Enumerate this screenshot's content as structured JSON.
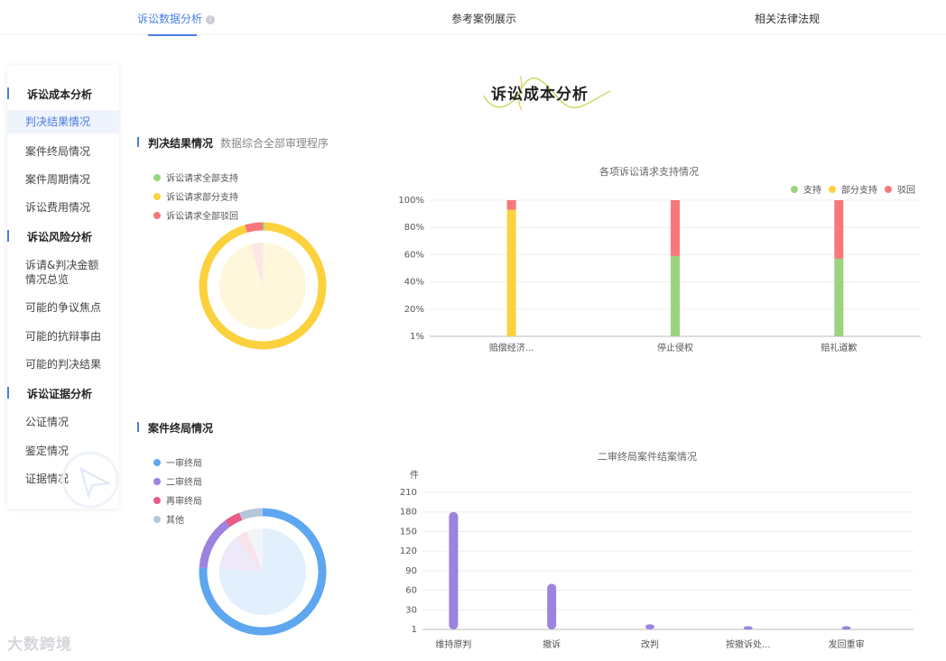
{
  "tabs": [
    {
      "label": "诉讼数据分析",
      "active": true
    },
    {
      "label": "参考案例展示",
      "active": false
    },
    {
      "label": "相关法律法规",
      "active": false
    }
  ],
  "sidebar": {
    "groups": [
      {
        "label": "诉讼成本分析",
        "items": [
          "判决结果情况",
          "案件终局情况",
          "案件周期情况",
          "诉讼费用情况"
        ]
      },
      {
        "label": "诉讼风险分析",
        "items": [
          "诉请&判决金额情况总览",
          "可能的争议焦点",
          "可能的抗辩事由",
          "可能的判决结果"
        ]
      },
      {
        "label": "诉讼证据分析",
        "items": [
          "公证情况",
          "鉴定情况",
          "证据情况"
        ]
      }
    ],
    "active_item": "判决结果情况"
  },
  "main_title": "诉讼成本分析",
  "section1": {
    "title": "判决结果情况",
    "subtitle": "数据综合全部审理程序",
    "legend": [
      {
        "label": "诉讼请求全部支持",
        "color": "#9bd47e"
      },
      {
        "label": "诉讼请求部分支持",
        "color": "#fcd13e"
      },
      {
        "label": "诉讼请求全部驳回",
        "color": "#f8777a"
      }
    ]
  },
  "section2": {
    "title": "案件终局情况",
    "legend": [
      {
        "label": "一审终局",
        "color": "#5ea7f0"
      },
      {
        "label": "二审终局",
        "color": "#9b83df"
      },
      {
        "label": "再审终局",
        "color": "#e85c86"
      },
      {
        "label": "其他",
        "color": "#b6c6d9"
      }
    ]
  },
  "chart_data": [
    {
      "type": "pie",
      "slices": [
        {
          "label": "诉讼请求全部支持",
          "value": 0.5,
          "color": "#9bd47e"
        },
        {
          "label": "诉讼请求部分支持",
          "value": 95,
          "color": "#fcd13e"
        },
        {
          "label": "诉讼请求全部驳回",
          "value": 4.5,
          "color": "#f8777a"
        }
      ]
    },
    {
      "type": "bar",
      "stacked": true,
      "title": "各项诉讼请求支持情况",
      "categories": [
        "赔偿经济...",
        "停止侵权",
        "赔礼道歉"
      ],
      "series": [
        {
          "name": "支持",
          "color": "#9bd47e",
          "values": [
            0,
            59,
            57
          ]
        },
        {
          "name": "部分支持",
          "color": "#fcd13e",
          "values": [
            93,
            0,
            0
          ]
        },
        {
          "name": "驳回",
          "color": "#f8777a",
          "values": [
            7,
            41,
            43
          ]
        }
      ],
      "y_ticks": [
        "1%",
        "20%",
        "40%",
        "60%",
        "80%",
        "100%"
      ],
      "ylim": [
        0,
        100
      ],
      "legend": "top-right",
      "grid": true
    },
    {
      "type": "pie",
      "slices": [
        {
          "label": "一审终局",
          "value": 76,
          "color": "#5ea7f0"
        },
        {
          "label": "二审终局",
          "value": 14,
          "color": "#9b83df"
        },
        {
          "label": "再审终局",
          "value": 4,
          "color": "#e85c86"
        },
        {
          "label": "其他",
          "value": 6,
          "color": "#b6c6d9"
        }
      ]
    },
    {
      "type": "bar",
      "title": "二审终局案件结案情况",
      "ylabel": "件",
      "categories": [
        "维持原判",
        "撤诉",
        "改判",
        "按撤诉处...",
        "发回重审"
      ],
      "values": [
        180,
        70,
        8,
        5,
        5
      ],
      "color": "#9b83df",
      "y_ticks": [
        "1",
        "30",
        "60",
        "90",
        "120",
        "150",
        "180",
        "210"
      ],
      "ylim": [
        0,
        210
      ],
      "grid": true
    }
  ],
  "watermark": "大数跨境"
}
